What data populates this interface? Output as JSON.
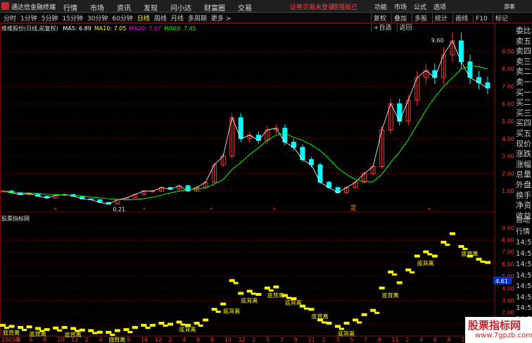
{
  "app": {
    "name": "通达信金融终端",
    "menus": [
      "行情",
      "市场",
      "资讯",
      "发现",
      "问小达",
      "财富圈",
      "交易"
    ],
    "notice": "证券交易未登录",
    "notice2": "增强版已",
    "right_menus": [
      "功能",
      "市场",
      "公式",
      "选项"
    ],
    "guest": "游客"
  },
  "toolbar": {
    "periods": [
      "分时",
      "1分钟",
      "5分钟",
      "15分钟",
      "30分钟",
      "60分钟",
      "日线",
      "周线",
      "月线",
      "多周期",
      "更多 >"
    ],
    "selected": "日线",
    "tools": [
      "复权",
      "叠加",
      "多股",
      "统计",
      "画线",
      "F10",
      "标记",
      "+自选",
      "返回"
    ]
  },
  "main_chart": {
    "name": "维维股份(日线,前复权)",
    "ma": [
      {
        "label": "MA5:",
        "value": "6.89",
        "color": "#ffffff"
      },
      {
        "label": "MA10:",
        "value": "7.05",
        "color": "#ffff00"
      },
      {
        "label": "MA20:",
        "value": "7.07",
        "color": "#ff00ff"
      },
      {
        "label": "MA60:",
        "value": "7.45",
        "color": "#00ff00"
      }
    ],
    "y_ticks": [
      "9.00",
      "8.00",
      "7.00",
      "6.00",
      "5.00",
      "4.00",
      "3.00",
      "2.00",
      "1.00"
    ],
    "high_label": "9.60",
    "low_label": "0.21",
    "marker": "定"
  },
  "sub_chart": {
    "name": "股票指标网",
    "y_ticks": [
      "9.00",
      "8.00",
      "7.00",
      "6.00",
      "5.00",
      "4.00",
      "3.00",
      "2.00",
      "1.00"
    ],
    "current_value": "4.61",
    "labels": [
      "底背离",
      "底背离",
      "底背离",
      "底背离",
      "底背离",
      "底背离",
      "底背离",
      "底背离",
      "底背离",
      "底背离",
      "底背离",
      "底背离",
      "底背离",
      "底背离"
    ]
  },
  "x_axis": [
    "2003年",
    "4",
    "6",
    "8",
    "10",
    "12",
    "2",
    "4",
    "6",
    "8",
    "10",
    "12",
    "2",
    "4",
    "6",
    "8",
    "10",
    "12",
    "2",
    "5",
    "7",
    "9",
    "11",
    "1",
    "3",
    "5",
    "7",
    "9",
    "11",
    "2",
    "4",
    "6",
    "8",
    "10",
    "12",
    "3"
  ],
  "side_quote": [
    "委比",
    "卖五",
    "卖四",
    "卖三",
    "卖二",
    "卖一",
    "买一",
    "买二",
    "买三",
    "买四",
    "买五",
    "现价",
    "涨跌",
    "涨幅",
    "总量",
    "外盘",
    "换手",
    "净资",
    "收益"
  ],
  "side_quote2": [
    "自动",
    "行情",
    "14:50",
    "14:50",
    "14:50",
    "14:50",
    "14:50",
    "14:50",
    "14:50",
    "14:50",
    "14:50",
    "14:50"
  ],
  "watermark": {
    "title": "股票指标网",
    "url": "www.7gpzb.com"
  },
  "colors": {
    "background": "#000000",
    "grid": "#7a0000",
    "up": "#ff3333",
    "down": "#00ffff",
    "axis_text": "#ff3333",
    "signal": "#ffff00"
  },
  "chart_data": {
    "type": "line",
    "series": [
      {
        "values": [
          1,
          0.9,
          0.8,
          0.85,
          0.7,
          0.6,
          0.75,
          0.8,
          0.7,
          0.55,
          0.5,
          0.35,
          0.25,
          0.5,
          0.6,
          0.8,
          1,
          1,
          1.2,
          1.1,
          1.3,
          1,
          1.2,
          1.5,
          2.5,
          3,
          5.2,
          4,
          4.2,
          3.9,
          4.5,
          4.6,
          3.8,
          3.5,
          2.8,
          2.5,
          1.5,
          1.2,
          0.9,
          1.2,
          1.5,
          2,
          2.4,
          4.5,
          6,
          5,
          6.2,
          7.5,
          7.9,
          7.5,
          8.8,
          9.6,
          8.4,
          7.5,
          7.2,
          6.9
        ]
      }
    ]
  }
}
